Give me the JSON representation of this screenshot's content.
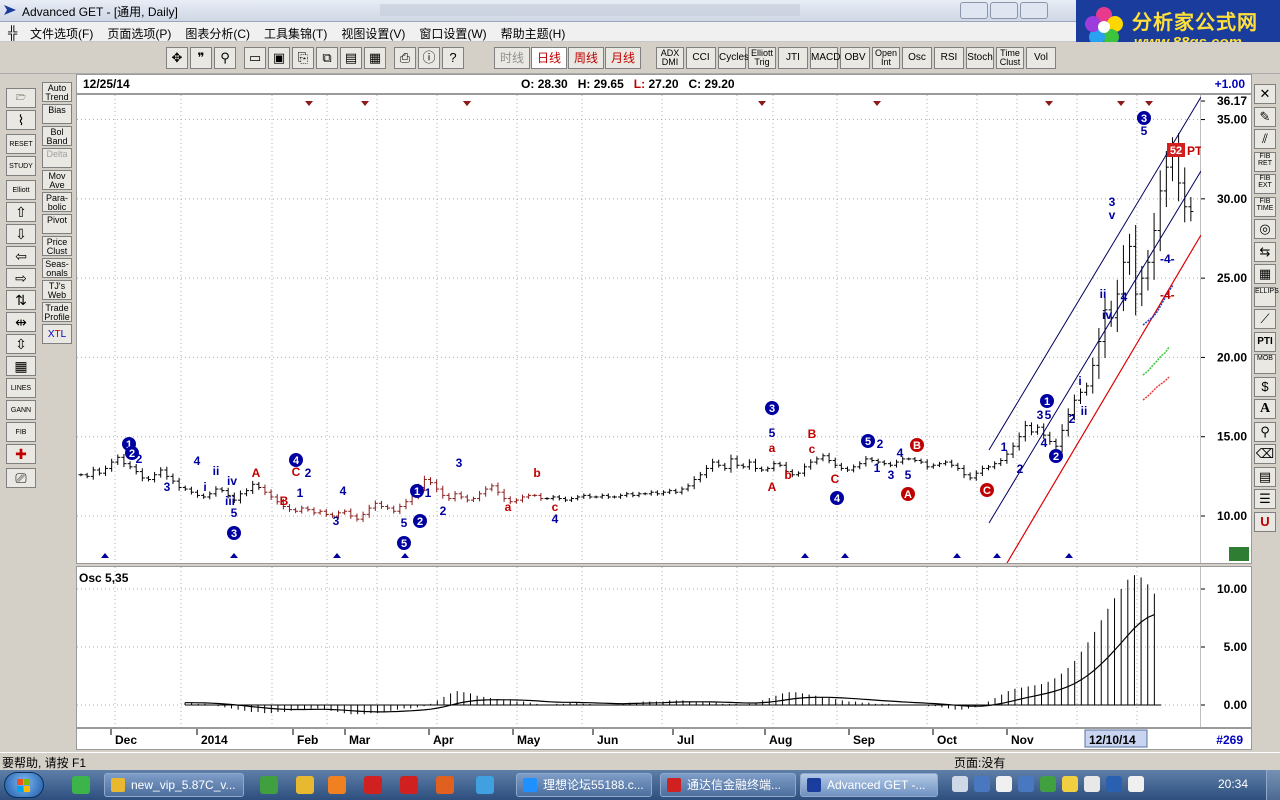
{
  "window": {
    "title": "Advanced GET - [通用, Daily]"
  },
  "logo": {
    "name": "分析家公式网",
    "url": "www.88gs.com"
  },
  "menu": {
    "items": [
      "文件选项(F)",
      "页面选项(P)",
      "图表分析(C)",
      "工具集锦(T)",
      "视图设置(V)",
      "窗口设置(W)",
      "帮助主题(H)"
    ]
  },
  "toolbar": {
    "periods": [
      "时线",
      "日线",
      "周线",
      "月线"
    ],
    "active_period": "日线",
    "studies": [
      "ADX DMI",
      "CCI",
      "Cycles",
      "Elliott Trig",
      "JTI",
      "MACD",
      "OBV",
      "Open Int",
      "Osc",
      "RSI",
      "Stoch",
      "Time Clust",
      "Vol"
    ]
  },
  "left_studies": [
    "Auto Trend",
    "Bias",
    "Bol Band",
    "Delta",
    "Mov Ave",
    "Para-bolic",
    "Pivot",
    "Price Clust",
    "Seas-onals",
    "TJ's Web",
    "Trade Profile"
  ],
  "left_tools": [
    "RESET",
    "STUDY",
    "Elliott",
    "LINES",
    "GANN",
    "FIB"
  ],
  "xtl_button": {
    "x": "X",
    "t": "T",
    "l": "L"
  },
  "right_tools": [
    "FIB RET",
    "FIB EXT",
    "FIB TIME",
    "ELLIPS",
    "PTI",
    "MOB",
    "A"
  ],
  "info": {
    "date": "12/25/14",
    "open_label": "O:",
    "open": "28.30",
    "high_label": "H:",
    "high": "29.65",
    "low_label": "L:",
    "low": "27.20",
    "close_label": "C:",
    "close": "29.20",
    "change": "+1.00"
  },
  "price_axis": {
    "labels": [
      "36.17",
      "35.00",
      "30.00",
      "25.00",
      "20.00",
      "15.00",
      "10.00"
    ]
  },
  "annotations": {
    "pti_value": "52",
    "pti_label": "PTI",
    "target_label": "-4-"
  },
  "osc": {
    "label": "Osc 5,35",
    "labels": [
      "10.00",
      "5.00",
      "0.00"
    ]
  },
  "time_axis": {
    "months": [
      "Dec",
      "2014",
      "Feb",
      "Mar",
      "Apr",
      "May",
      "Jun",
      "Jul",
      "Aug",
      "Sep",
      "Oct",
      "Nov"
    ],
    "current": "12/10/14",
    "bar_count": "#269"
  },
  "status": {
    "help": "要帮助, 请按 F1",
    "page": "页面:没有"
  },
  "taskbar": {
    "tasks": [
      "new_vip_5.87C_v...",
      "理想论坛55188.c...",
      "通达信金融终端...",
      "Advanced GET -..."
    ],
    "clock": "20:34"
  },
  "colors": {
    "wave_blue": "#0000a0",
    "wave_red": "#c00000",
    "bar_dark": "#000000",
    "bar_red": "#8b1a1a",
    "channel_blue": "#000060",
    "channel_red": "#e00000"
  },
  "chart_data": {
    "type": "ohlc",
    "price_ylim": [
      8.9,
      36.17
    ],
    "osc_ylim": [
      -1.0,
      11.5
    ],
    "series": [
      {
        "name": "Close",
        "values": [
          12.6,
          12.5,
          12.9,
          12.7,
          13.0,
          13.4,
          13.7,
          13.3,
          13.1,
          12.8,
          12.4,
          12.3,
          12.6,
          12.9,
          12.5,
          12.2,
          11.8,
          11.7,
          11.5,
          11.3,
          11.2,
          11.4,
          11.7,
          11.6,
          11.3,
          11.0,
          11.4,
          11.6,
          12.0,
          11.8,
          11.5,
          11.2,
          10.9,
          10.6,
          10.4,
          10.3,
          10.5,
          10.4,
          10.2,
          10.3,
          10.1,
          10.0,
          10.2,
          10.3,
          10.0,
          9.8,
          10.1,
          10.5,
          10.8,
          10.6,
          10.5,
          10.3,
          10.6,
          10.9,
          11.3,
          11.8,
          12.3,
          12.1,
          11.7,
          11.3,
          11.1,
          11.4,
          11.2,
          11.0,
          11.1,
          11.4,
          11.7,
          11.9,
          11.5,
          11.1,
          10.9,
          11.0,
          11.2,
          11.3,
          11.3,
          11.1,
          11.1,
          11.2,
          11.1,
          11.0,
          11.1,
          11.2,
          11.3,
          11.2,
          11.2,
          11.3,
          11.2,
          11.2,
          11.3,
          11.4,
          11.3,
          11.4,
          11.4,
          11.5,
          11.4,
          11.5,
          11.6,
          11.5,
          11.7,
          11.9,
          12.3,
          12.6,
          13.0,
          13.4,
          13.2,
          13.0,
          13.6,
          13.2,
          13.1,
          13.4,
          13.0,
          12.9,
          13.0,
          13.3,
          13.2,
          12.8,
          12.6,
          12.7,
          13.1,
          13.4,
          13.6,
          13.8,
          13.5,
          13.2,
          13.0,
          12.9,
          13.1,
          13.3,
          13.6,
          13.5,
          13.4,
          13.3,
          13.2,
          13.4,
          13.6,
          13.6,
          13.5,
          13.4,
          13.1,
          13.2,
          13.3,
          13.4,
          13.2,
          13.0,
          12.6,
          12.4,
          12.7,
          13.0,
          13.1,
          13.3,
          13.5,
          13.9,
          14.4,
          15.0,
          15.7,
          15.3,
          15.6,
          15.1,
          14.7,
          14.4,
          15.4,
          16.4,
          17.3,
          17.8,
          18.2,
          19.5,
          21.0,
          23.0,
          22.5,
          24.0,
          26.0,
          27.0,
          24.0,
          25.0,
          26.0,
          28.0,
          30.5,
          32.0,
          33.0,
          31.0,
          29.5,
          29.2
        ]
      },
      {
        "name": "Osc 5,35",
        "values": [
          0.2,
          0.2,
          0.1,
          0.1,
          0.0,
          -0.1,
          -0.2,
          -0.3,
          -0.4,
          -0.5,
          -0.6,
          -0.6,
          -0.7,
          -0.7,
          -0.6,
          -0.6,
          -0.5,
          -0.4,
          -0.4,
          -0.3,
          -0.3,
          -0.4,
          -0.5,
          -0.6,
          -0.7,
          -0.8,
          -0.8,
          -0.8,
          -0.7,
          -0.7,
          -0.6,
          -0.5,
          -0.4,
          -0.3,
          -0.3,
          -0.2,
          -0.1,
          0.1,
          0.4,
          0.7,
          1.0,
          1.2,
          1.1,
          1.0,
          0.8,
          0.7,
          0.6,
          0.5,
          0.4,
          0.4,
          0.3,
          0.3,
          0.2,
          0.1,
          0.0,
          0.0,
          0.1,
          0.1,
          0.2,
          0.2,
          0.1,
          0.1,
          0.0,
          0.0,
          0.0,
          0.0,
          0.1,
          0.2,
          0.2,
          0.3,
          0.3,
          0.3,
          0.3,
          0.4,
          0.4,
          0.4,
          0.3,
          0.3,
          0.3,
          0.2,
          0.2,
          0.1,
          0.1,
          0.1,
          0.0,
          0.1,
          0.2,
          0.4,
          0.6,
          0.8,
          1.0,
          1.1,
          1.1,
          1.0,
          0.9,
          0.8,
          0.7,
          0.6,
          0.5,
          0.4,
          0.3,
          0.3,
          0.2,
          0.2,
          0.1,
          0.1,
          0.1,
          0.0,
          0.0,
          0.0,
          0.0,
          0.0,
          -0.1,
          -0.1,
          -0.2,
          -0.3,
          -0.4,
          -0.4,
          -0.3,
          -0.2,
          0.0,
          0.3,
          0.6,
          0.9,
          1.2,
          1.4,
          1.5,
          1.6,
          1.7,
          1.8,
          2.0,
          2.3,
          2.7,
          3.2,
          3.8,
          4.6,
          5.4,
          6.3,
          7.3,
          8.3,
          9.2,
          10.0,
          10.8,
          11.2,
          11.0,
          10.4,
          9.6
        ]
      }
    ]
  }
}
